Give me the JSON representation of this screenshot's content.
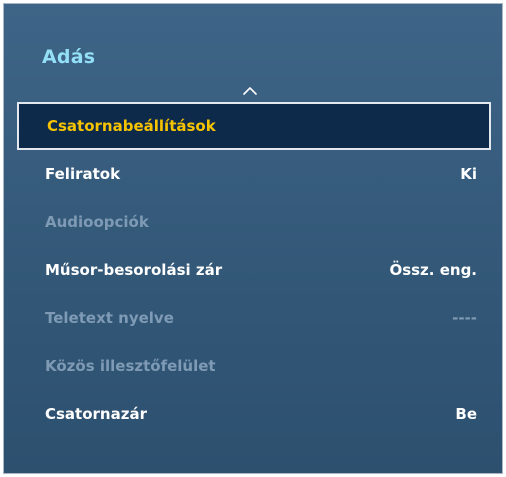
{
  "panel": {
    "title": "Adás",
    "scroll_up_icon": "chevron-up-icon"
  },
  "menu": {
    "items": [
      {
        "label": "Csatornabeállítások",
        "value": "",
        "state": "selected"
      },
      {
        "label": "Feliratok",
        "value": "Ki",
        "state": "enabled"
      },
      {
        "label": "Audioopciók",
        "value": "",
        "state": "disabled"
      },
      {
        "label": "Műsor-besorolási zár",
        "value": "Össz. eng.",
        "state": "enabled"
      },
      {
        "label": "Teletext nyelve",
        "value": "----",
        "state": "disabled"
      },
      {
        "label": "Közös illesztőfelület",
        "value": "",
        "state": "disabled"
      },
      {
        "label": "Csatornazár",
        "value": "Be",
        "state": "enabled"
      }
    ]
  },
  "colors": {
    "title": "#93dff5",
    "selected_text": "#f5c300",
    "enabled_text": "#ffffff",
    "disabled_text": "#7e9ab4",
    "panel_background": "#335878",
    "selected_background": "#0e2a4b"
  }
}
